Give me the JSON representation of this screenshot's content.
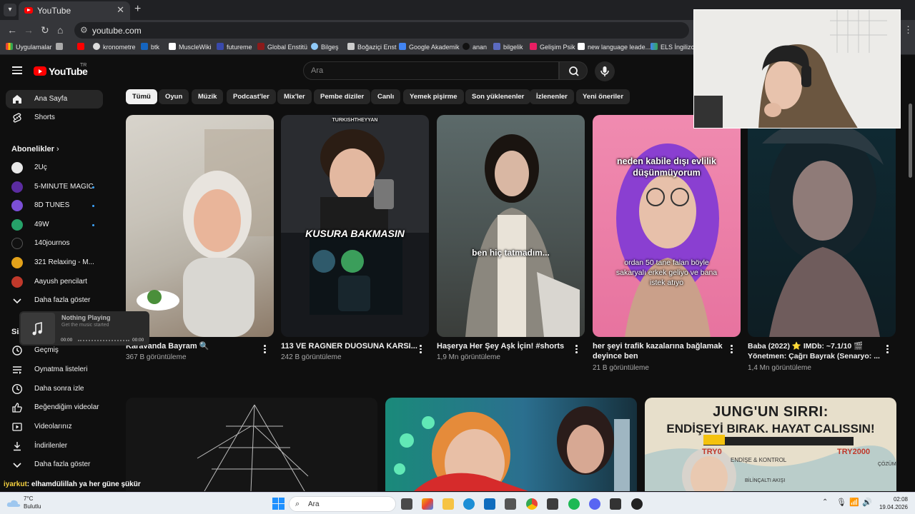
{
  "browser": {
    "tab_title": "YouTube",
    "new_tab": "+",
    "close": "✕",
    "url": "youtube.com",
    "bookmarks": [
      "Uygulamalar",
      "kronometre",
      "btk",
      "MuscleWiki",
      "futureme",
      "Global Enstitü",
      "Bilgeş",
      "Boğaziçi Enst",
      "Google Akademik",
      "anan",
      "bilgelik",
      "Gelişim Psik",
      "new language leade...",
      "ELS İngilizce"
    ]
  },
  "header": {
    "logo": "YouTube",
    "country": "TR",
    "search_placeholder": "Ara"
  },
  "sidebar": {
    "main": [
      {
        "label": "Ana Sayfa"
      },
      {
        "label": "Shorts"
      }
    ],
    "subs_title": "Abonelikler",
    "subs": [
      {
        "label": "2Uç",
        "color": "#e8e8e8"
      },
      {
        "label": "5-MINUTE MAGIC",
        "color": "#5b2ca0"
      },
      {
        "label": "8D TUNES",
        "color": "#7b4fd6"
      },
      {
        "label": "49W",
        "color": "#26a269"
      },
      {
        "label": "140journos",
        "color": "#111111"
      },
      {
        "label": "321 Relaxing - M...",
        "color": "#e3a21a"
      },
      {
        "label": "Aayush pencilart",
        "color": "#c0392b"
      }
    ],
    "more": "Daha fazla göster",
    "you_title": "Siz",
    "you": [
      {
        "label": "Geçmiş"
      },
      {
        "label": "Oynatma listeleri"
      },
      {
        "label": "Daha sonra izle"
      },
      {
        "label": "Beğendiğim videolar"
      },
      {
        "label": "Videolarınız"
      },
      {
        "label": "İndirilenler"
      },
      {
        "label": "Daha fazla göster"
      }
    ]
  },
  "chips": [
    "Tümü",
    "Oyun",
    "Müzik",
    "Podcast'ler",
    "Mix'ler",
    "Pembe diziler",
    "Canlı",
    "Yemek pişirme",
    "Son yüklenenler",
    "İzlenenler",
    "Yeni öneriler"
  ],
  "shorts": [
    {
      "title": "Karavanda Bayram 🔍",
      "title2": "",
      "views": "367 B görüntüleme",
      "overlay": ""
    },
    {
      "title": "113 VE RAGNER DUOSUNA KARSI...",
      "title2": "",
      "views": "242 B görüntüleme",
      "overlay": "KUSURA BAKMASIN",
      "watermark": "TURKISHTHEYYAN"
    },
    {
      "title": "Haşerya Her Şey Aşk İçin! #shorts",
      "title2": "",
      "views": "1,9 Mn görüntüleme",
      "overlay": "ben hiç tatmadım..."
    },
    {
      "title": "her şeyi trafik kazalarına bağlamak",
      "title2": "deyince ben",
      "views": "21 B görüntüleme",
      "overlay": "neden kabile dışı evlilik düşünmüyorum",
      "overlay2": "ordan 50 tane falan böyle sakaryalı erkek geliyo ve bana istek atıyo"
    },
    {
      "title": "Baba (2022) ⭐ IMDb: ~7.1/10 🎬",
      "title2": "Yönetmen: Çağrı Bayrak (Senaryo: ...",
      "views": "1,4 Mn görüntüleme",
      "overlay": ""
    }
  ],
  "videos": [
    {
      "overlay": ""
    },
    {
      "overlay": ""
    },
    {
      "line1": "JUNG'UN SIRRI:",
      "line2": "ENDİŞEYİ BIRAK. HAYAT CALISSIN!",
      "tag1": "TRY0",
      "tag2": "TRY2000",
      "mid": "ENDİŞE & KONTROL",
      "mid2": "BİLİNÇALTI AKIŞI",
      "corner": "ÇÖZÜM"
    }
  ],
  "music": {
    "title": "Nothing Playing",
    "subtitle": "Get the music started",
    "time_start": "00:00",
    "time_end": "00:00"
  },
  "chat": {
    "user": "iyarkut",
    "message": ": elhamdülillah ya her güne şükür"
  },
  "taskbar": {
    "temp": "7°C",
    "condition": "Bulutlu",
    "search": "Ara",
    "time": "02:08",
    "date": "19.04.2026"
  }
}
